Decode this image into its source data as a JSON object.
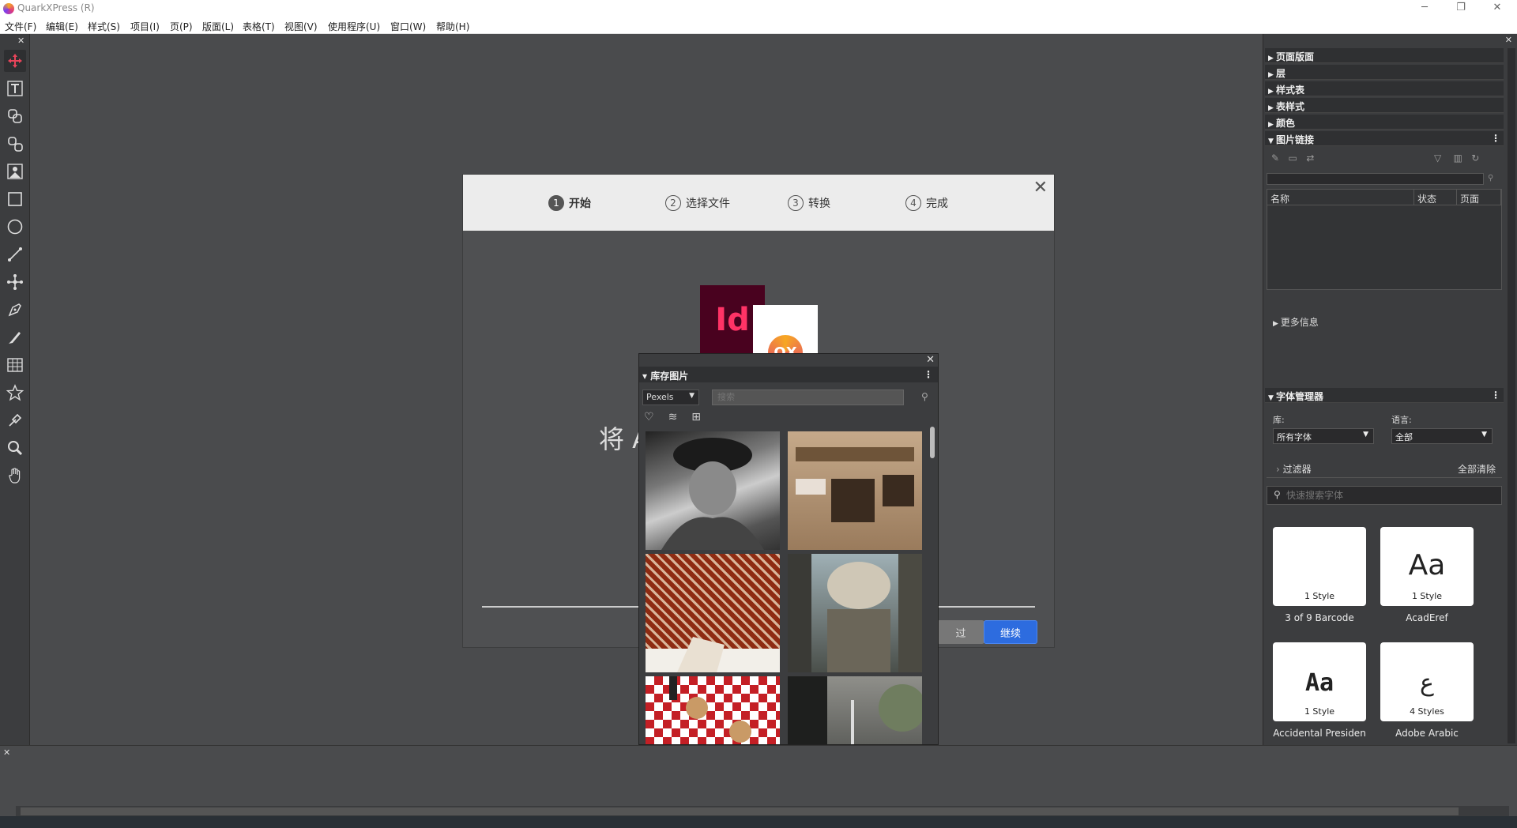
{
  "window": {
    "title": "QuarkXPress (R)",
    "controls": [
      "─",
      "❐",
      "✕"
    ]
  },
  "menu": [
    "文件(F)",
    "编辑(E)",
    "样式(S)",
    "项目(I)",
    "页(P)",
    "版面(L)",
    "表格(T)",
    "视图(V)",
    "使用程序(U)",
    "窗口(W)",
    "帮助(H)"
  ],
  "toolbox": {
    "close": "✕",
    "tools": [
      "item-tool",
      "text-content-tool",
      "text-linking-tool",
      "text-unlinking-tool",
      "picture-content-tool",
      "rectangle-box-tool",
      "oval-box-tool",
      "line-tool",
      "bezier-tool",
      "bezier-pen-tool",
      "freehand-tool",
      "table-tool",
      "star-tool",
      "eyedropper-tool",
      "zoom-tool",
      "pan-tool"
    ]
  },
  "wizard": {
    "steps": [
      {
        "num": "1",
        "label": "开始"
      },
      {
        "num": "2",
        "label": "选择文件"
      },
      {
        "num": "3",
        "label": "转换"
      },
      {
        "num": "4",
        "label": "完成"
      }
    ],
    "close": "✕",
    "id_logo": "Id",
    "qx_logo": "QX",
    "headline": "将 A",
    "skip_label": "过",
    "continue_label": "继续"
  },
  "stock": {
    "close": "✕",
    "title": "库存图片",
    "menu": "⋮",
    "source": "Pexels",
    "search_placeholder": "搜索",
    "icons": [
      "♡",
      "≋",
      "⊞"
    ]
  },
  "right": {
    "close": "✕",
    "sections": [
      "页面版面",
      "层",
      "样式表",
      "表样式",
      "颜色"
    ],
    "picture_links": {
      "title": "图片链接",
      "menu": "⋮",
      "columns": [
        "名称",
        "状态",
        "页面"
      ]
    },
    "more_info": "更多信息",
    "font_manager": {
      "title": "字体管理器",
      "menu": "⋮",
      "library_label": "库:",
      "library_value": "所有字体",
      "language_label": "语言:",
      "language_value": "全部",
      "filters_label": "过滤器",
      "clear_all": "全部清除",
      "search_placeholder": "快速搜索字体",
      "fonts": [
        {
          "glyph": "",
          "styles": "1 Style",
          "name": "3 of 9 Barcode"
        },
        {
          "glyph": "Aa",
          "styles": "1 Style",
          "name": "AcadEref"
        },
        {
          "glyph": "Aa",
          "styles": "1 Style",
          "name": "Accidental Presiden"
        },
        {
          "glyph": "ع",
          "styles": "4 Styles",
          "name": "Adobe Arabic"
        }
      ]
    }
  },
  "bottom": {
    "close": "✕"
  },
  "colors": {
    "accent": "#2d6cdf",
    "id_brand": "#49021f",
    "id_text": "#ff3366"
  }
}
